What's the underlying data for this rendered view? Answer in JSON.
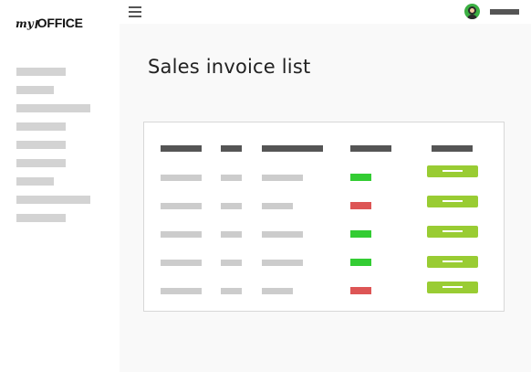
{
  "app": {
    "logo_prefix": "my",
    "logo_name": "OFFICE"
  },
  "topbar": {
    "menu_icon": "hamburger-icon",
    "avatar_icon": "user-avatar-icon"
  },
  "sidebar": {
    "items": [
      {
        "label": ""
      },
      {
        "label": ""
      },
      {
        "label": ""
      },
      {
        "label": ""
      },
      {
        "label": ""
      },
      {
        "label": ""
      },
      {
        "label": ""
      },
      {
        "label": ""
      },
      {
        "label": ""
      }
    ]
  },
  "main": {
    "title": "Sales invoice list"
  },
  "table": {
    "columns": [
      "",
      "",
      "",
      "",
      ""
    ],
    "rows": [
      {
        "status": "green"
      },
      {
        "status": "red"
      },
      {
        "status": "green"
      },
      {
        "status": "green"
      },
      {
        "status": "red"
      }
    ]
  },
  "colors": {
    "status_green": "#33cc33",
    "status_red": "#dd5555",
    "action_button": "#99cc33"
  }
}
